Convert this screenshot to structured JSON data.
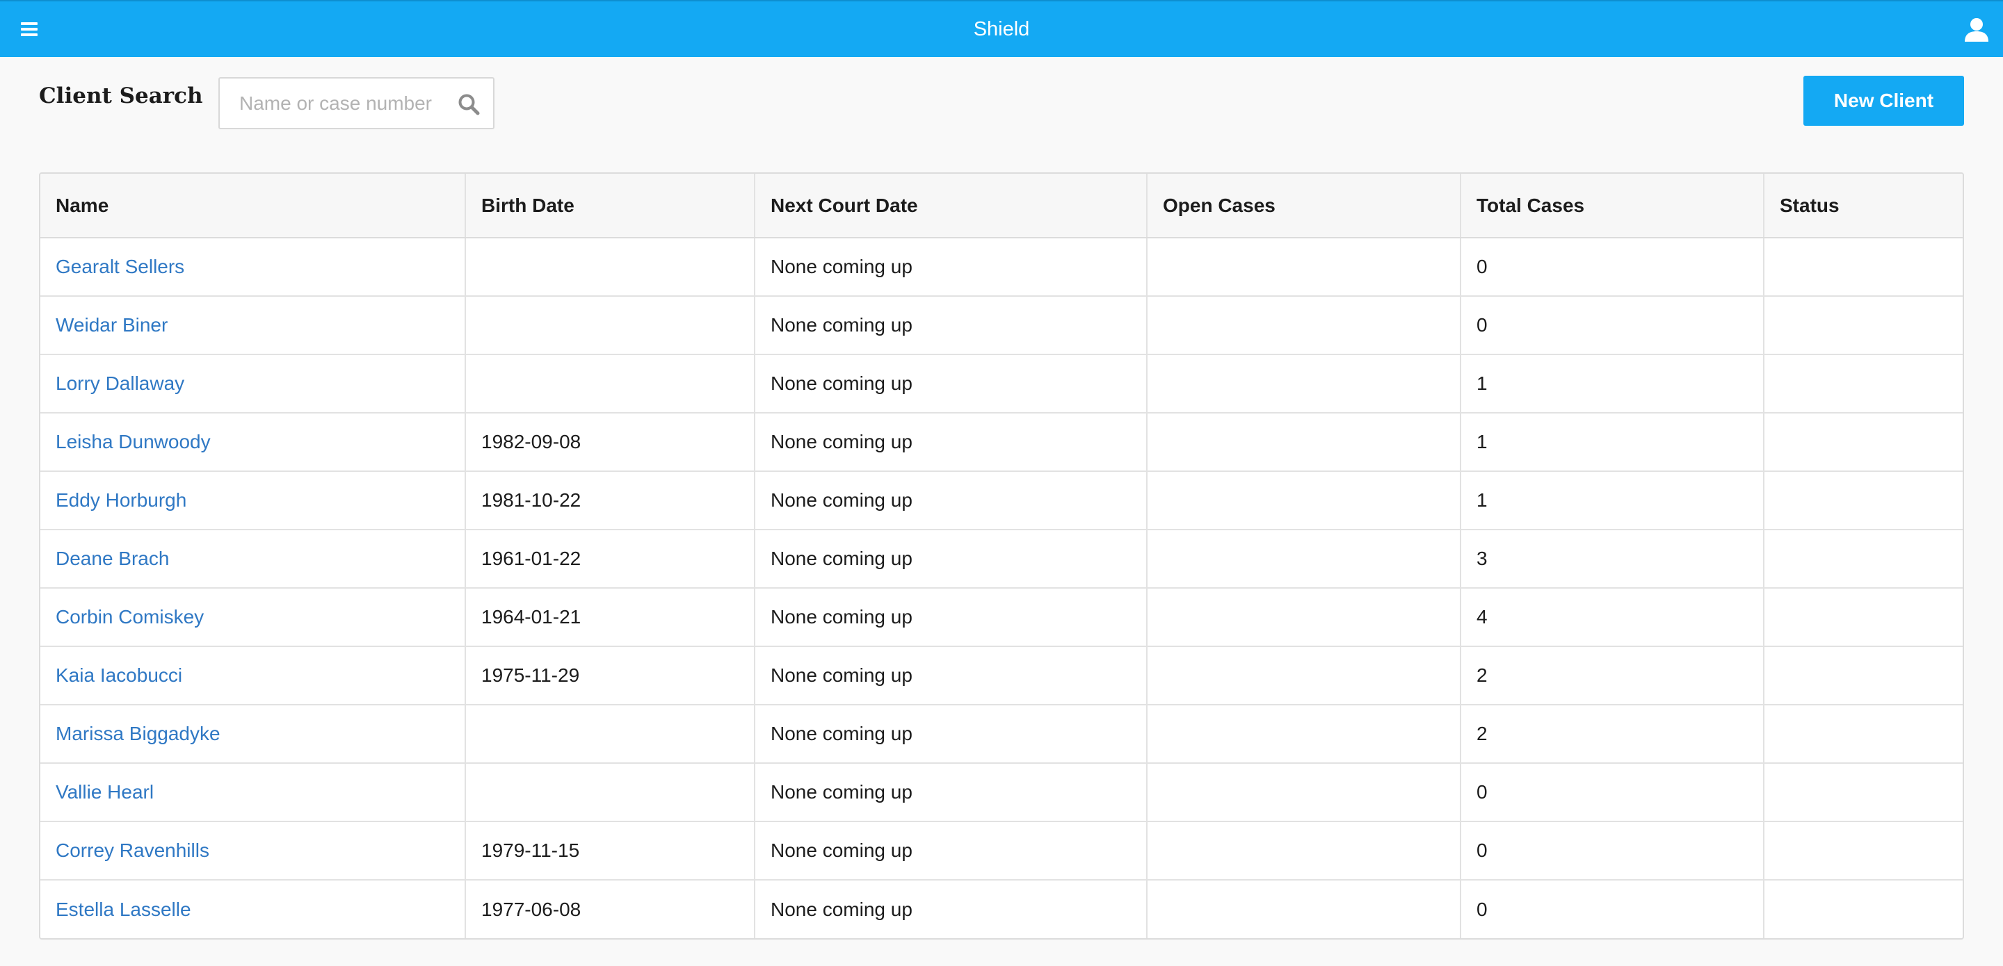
{
  "header": {
    "app_title": "Shield",
    "brand_color": "#14a9f3",
    "menu_icon": "hamburger-menu-icon",
    "user_icon": "user-icon"
  },
  "page": {
    "heading": "Client Search",
    "search": {
      "placeholder": "Name or case number",
      "value": "",
      "icon": "search-icon"
    },
    "new_client_label": "New Client"
  },
  "table": {
    "columns": [
      "Name",
      "Birth Date",
      "Next Court Date",
      "Open Cases",
      "Total Cases",
      "Status"
    ],
    "rows": [
      {
        "name": "Gearalt Sellers",
        "birth_date": "",
        "next_court_date": "None coming up",
        "open_cases": "",
        "total_cases": "0",
        "status": ""
      },
      {
        "name": "Weidar Biner",
        "birth_date": "",
        "next_court_date": "None coming up",
        "open_cases": "",
        "total_cases": "0",
        "status": ""
      },
      {
        "name": "Lorry Dallaway",
        "birth_date": "",
        "next_court_date": "None coming up",
        "open_cases": "",
        "total_cases": "1",
        "status": ""
      },
      {
        "name": "Leisha Dunwoody",
        "birth_date": "1982-09-08",
        "next_court_date": "None coming up",
        "open_cases": "",
        "total_cases": "1",
        "status": ""
      },
      {
        "name": "Eddy Horburgh",
        "birth_date": "1981-10-22",
        "next_court_date": "None coming up",
        "open_cases": "",
        "total_cases": "1",
        "status": ""
      },
      {
        "name": "Deane Brach",
        "birth_date": "1961-01-22",
        "next_court_date": "None coming up",
        "open_cases": "",
        "total_cases": "3",
        "status": ""
      },
      {
        "name": "Corbin Comiskey",
        "birth_date": "1964-01-21",
        "next_court_date": "None coming up",
        "open_cases": "",
        "total_cases": "4",
        "status": ""
      },
      {
        "name": "Kaia Iacobucci",
        "birth_date": "1975-11-29",
        "next_court_date": "None coming up",
        "open_cases": "",
        "total_cases": "2",
        "status": ""
      },
      {
        "name": "Marissa Biggadyke",
        "birth_date": "",
        "next_court_date": "None coming up",
        "open_cases": "",
        "total_cases": "2",
        "status": ""
      },
      {
        "name": "Vallie Hearl",
        "birth_date": "",
        "next_court_date": "None coming up",
        "open_cases": "",
        "total_cases": "0",
        "status": ""
      },
      {
        "name": "Correy Ravenhills",
        "birth_date": "1979-11-15",
        "next_court_date": "None coming up",
        "open_cases": "",
        "total_cases": "0",
        "status": ""
      },
      {
        "name": "Estella Lasselle",
        "birth_date": "1977-06-08",
        "next_court_date": "None coming up",
        "open_cases": "",
        "total_cases": "0",
        "status": ""
      }
    ]
  }
}
